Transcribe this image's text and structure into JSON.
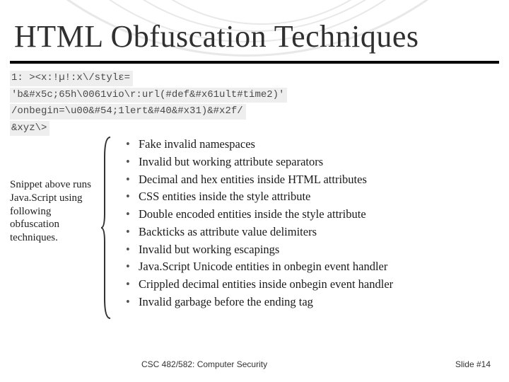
{
  "title": "HTML Obfuscation Techniques",
  "code": {
    "line1": "1: ><x:!µ!:x\\/stylε=",
    "line2": "'b&#x5c;65h\\0061vio\\r:url(#def&#x61ult#time2)'",
    "line3": "/onbegin=\\u00&#54;1lert&#40&#x31)&#x2f/",
    "line4": "&xyz\\>"
  },
  "caption": "Snippet above runs Java.Script using following obfuscation techniques.",
  "bullets": [
    "Fake invalid namespaces",
    "Invalid but working attribute separators",
    "Decimal and hex entities inside HTML attributes",
    "CSS entities inside the style attribute",
    "Double encoded entities inside the style attribute",
    "Backticks as attribute value delimiters",
    "Invalid but working escapings",
    "Java.Script Unicode entities in onbegin event handler",
    "Crippled decimal entities inside onbegin event handler",
    "Invalid garbage before the ending tag"
  ],
  "footer": {
    "left": "CSC 482/582: Computer Security",
    "right": "Slide #14"
  }
}
